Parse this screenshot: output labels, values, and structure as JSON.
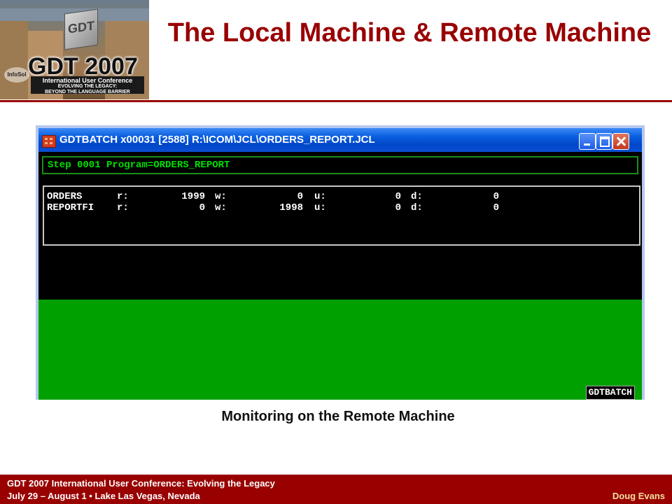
{
  "slide": {
    "title": "The Local Machine & Remote Machine",
    "caption": "Monitoring on the Remote Machine"
  },
  "logo": {
    "cube_text": "GDT",
    "wordmark": "GDT 2007",
    "band_line1": "International User Conference",
    "band_line2": "EVOLVING THE LEGACY:",
    "band_line3": "BEYOND THE LANGUAGE BARRIER",
    "partner": "InfoSol"
  },
  "window": {
    "title": "GDTBATCH x00031 [2588] R:\\ICOM\\JCL\\ORDERS_REPORT.JCL",
    "step_line": "Step 0001 Program=ORDERS_REPORT",
    "rows": [
      {
        "name": "ORDERS",
        "r_label": "r:",
        "r": "1999",
        "w_label": "w:",
        "w": "0",
        "u_label": "u:",
        "u": "0",
        "d_label": "d:",
        "d": "0"
      },
      {
        "name": "REPORTFI",
        "r_label": "r:",
        "r": "0",
        "w_label": "w:",
        "w": "1998",
        "u_label": "u:",
        "u": "0",
        "d_label": "d:",
        "d": "0"
      }
    ],
    "status_tag": "GDTBATCH"
  },
  "footer": {
    "line1": "GDT 2007 International User Conference: Evolving the Legacy",
    "line2": "July 29 – August 1  •  Lake Las Vegas, Nevada",
    "author": "Doug Evans"
  },
  "colors": {
    "brand_red": "#990000",
    "console_green": "#00a000",
    "titlebar_blue": "#0a5fe0"
  }
}
